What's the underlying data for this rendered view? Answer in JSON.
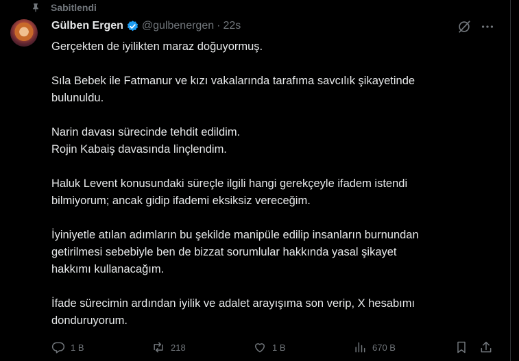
{
  "pinned_label": "Sabitlendi",
  "author": {
    "name": "Gülben Ergen",
    "handle": "@gulbenergen",
    "separator": "·",
    "time": "22s"
  },
  "tweet": {
    "paragraphs": [
      [
        "Gerçekten de iyilikten maraz doğuyormuş."
      ],
      [
        "Sıla Bebek ile Fatmanur ve kızı vakalarında tarafıma savcılık şikayetinde",
        "bulunuldu."
      ],
      [
        "Narin davası sürecinde tehdit edildim.",
        "Rojin Kabaiş davasında linçlendim."
      ],
      [
        "Haluk Levent konusundaki süreçle ilgili hangi gerekçeyle ifadem istendi",
        "bilmiyorum; ancak gidip ifademi eksiksiz vereceğim."
      ],
      [
        "İyiniyetle atılan adımların bu şekilde manipüle edilip insanların burnundan",
        "getirilmesi sebebiyle ben de bizzat sorumlular hakkında yasal şikayet",
        "hakkımı kullanacağım."
      ],
      [
        "İfade sürecimin ardından iyilik ve adalet arayışıma son verip, X hesabımı",
        "donduruyorum."
      ]
    ]
  },
  "actions": {
    "replies": "1 B",
    "reposts": "218",
    "likes": "1 B",
    "views": "670 B"
  },
  "colors": {
    "background": "#000000",
    "text": "#e7e9ea",
    "muted": "#71767b",
    "verified": "#1d9bf0"
  }
}
